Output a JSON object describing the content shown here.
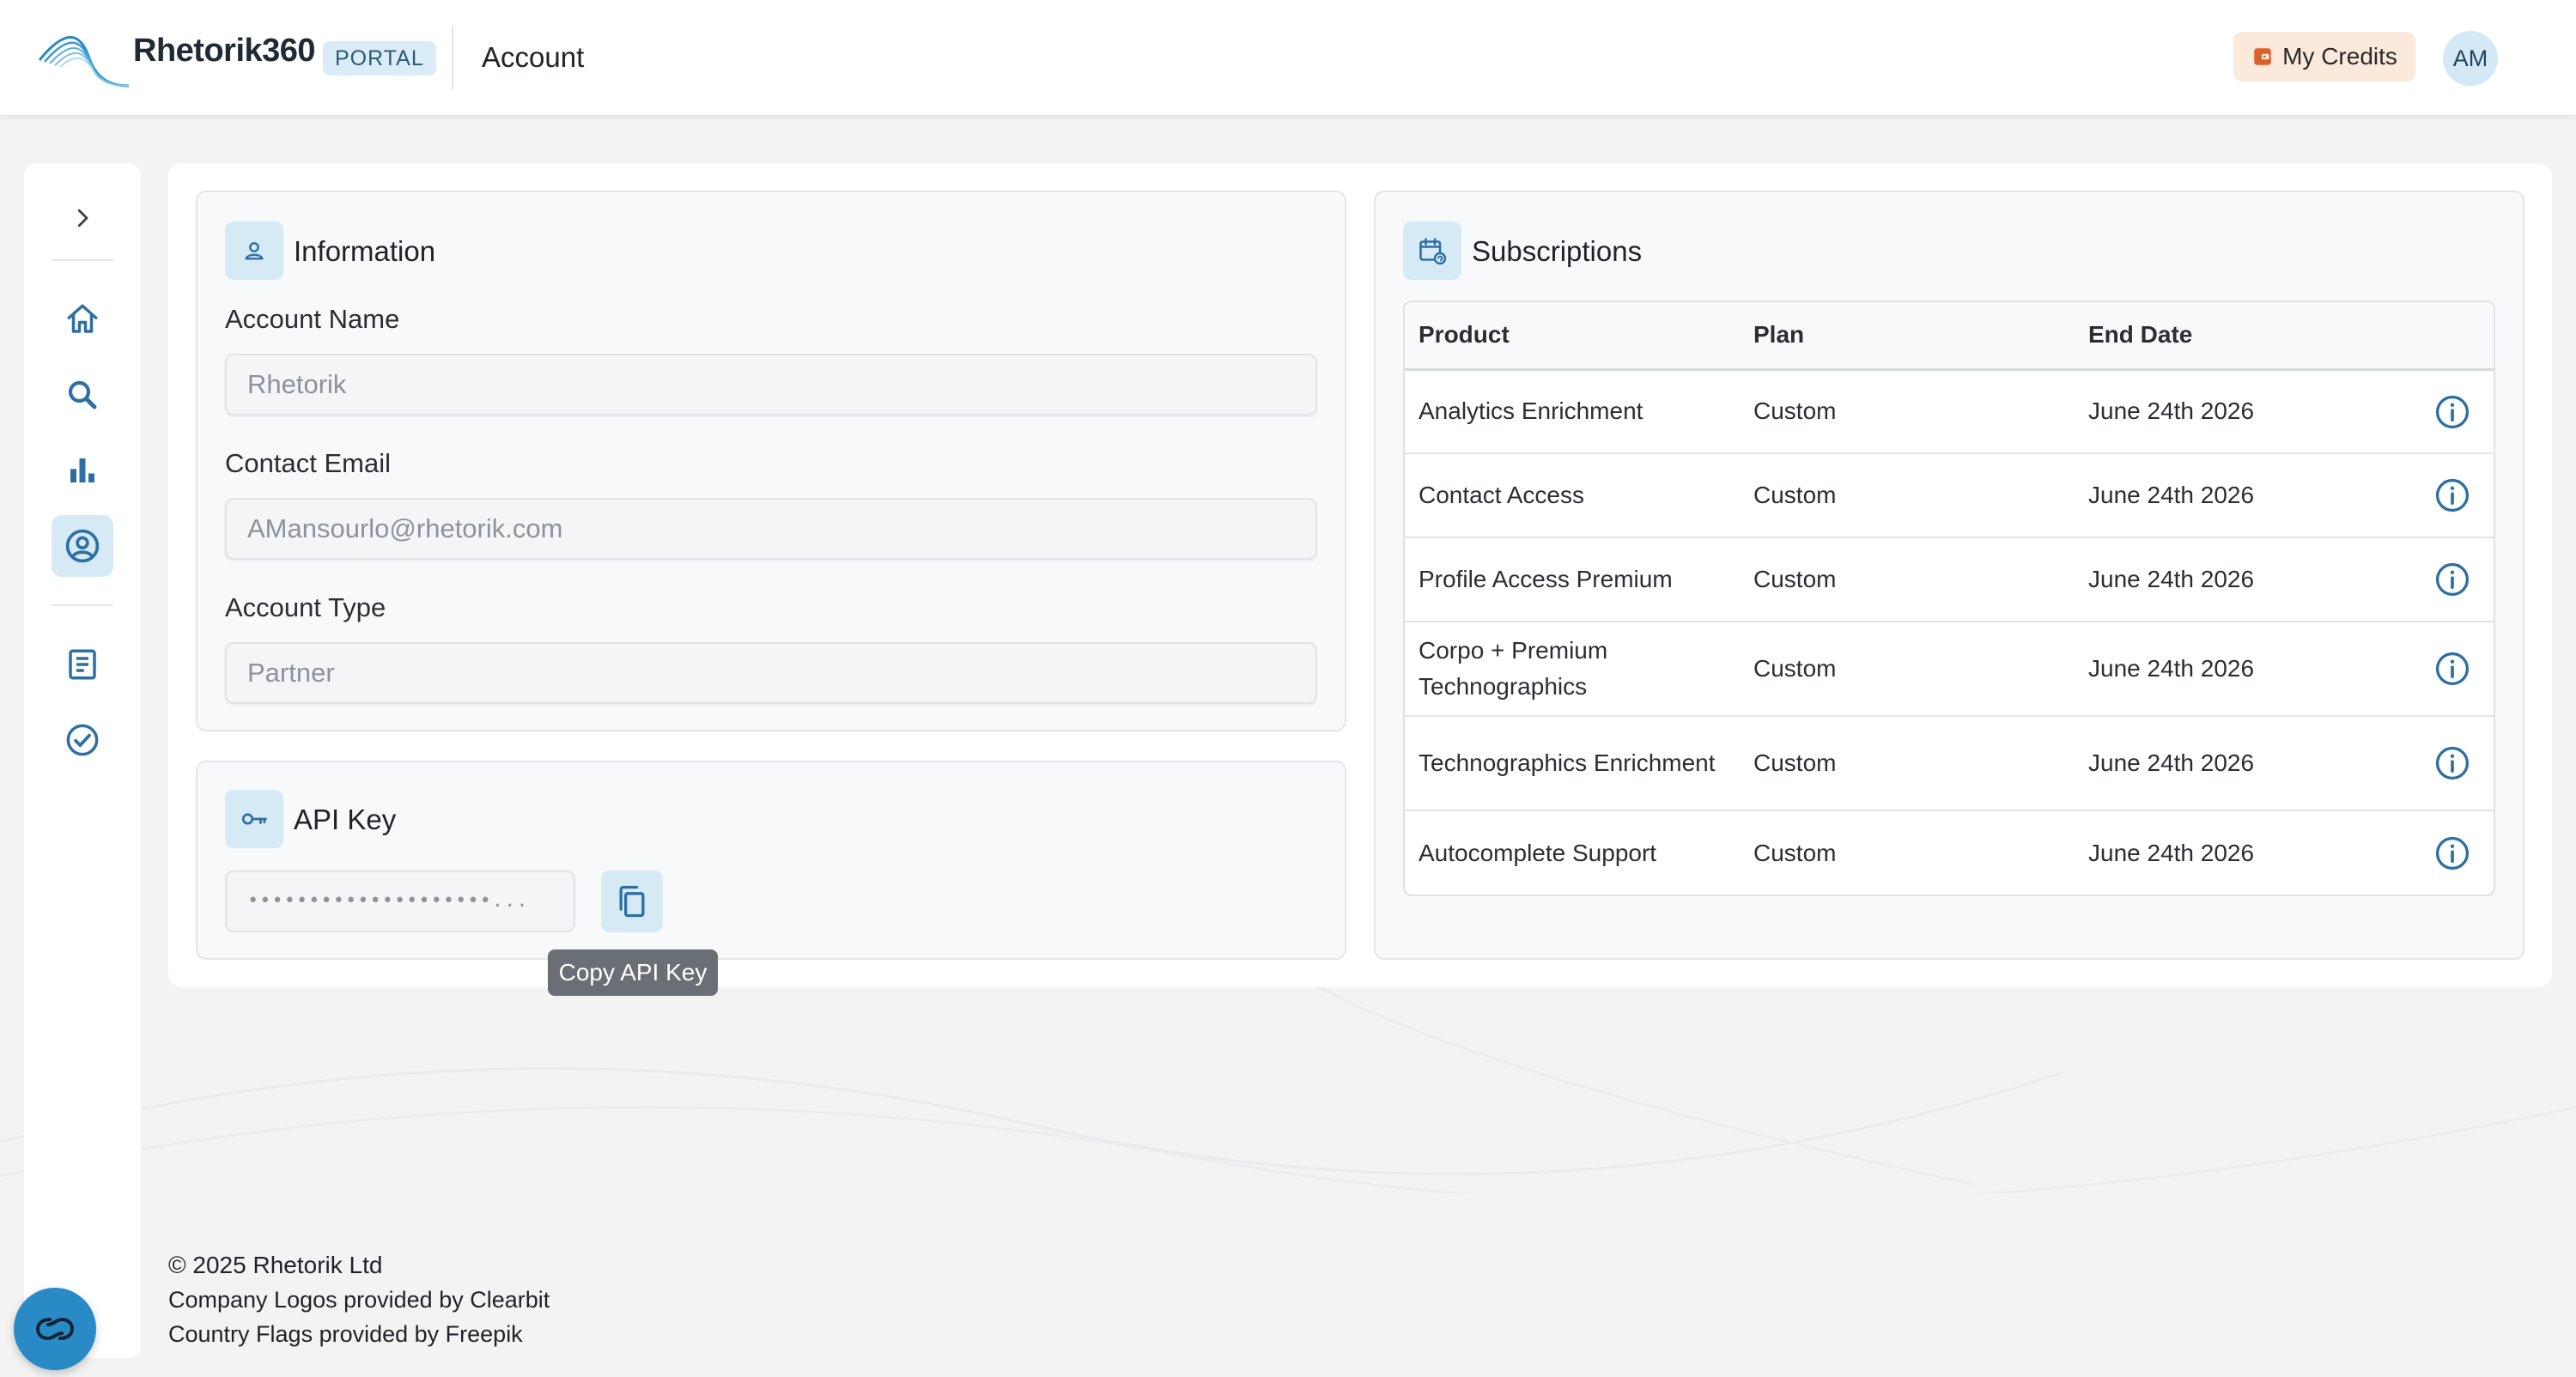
{
  "header": {
    "brand": "Rhetorik360",
    "badge": "PORTAL",
    "page_title": "Account",
    "credits_label": "My Credits",
    "avatar_initials": "AM"
  },
  "information": {
    "title": "Information",
    "account_name_label": "Account Name",
    "account_name_value": "Rhetorik",
    "contact_email_label": "Contact Email",
    "contact_email_value": "AMansourlo@rhetorik.com",
    "account_type_label": "Account Type",
    "account_type_value": "Partner"
  },
  "api_key": {
    "title": "API Key",
    "masked_value": "••••••••••••••••••••...",
    "tooltip": "Copy API Key"
  },
  "subscriptions": {
    "title": "Subscriptions",
    "columns": [
      "Product",
      "Plan",
      "End Date"
    ],
    "rows": [
      {
        "product": "Analytics Enrichment",
        "plan": "Custom",
        "end_date": "June 24th 2026"
      },
      {
        "product": "Contact Access",
        "plan": "Custom",
        "end_date": "June 24th 2026"
      },
      {
        "product": "Profile Access Premium",
        "plan": "Custom",
        "end_date": "June 24th 2026"
      },
      {
        "product": "Corpo + Premium Technographics",
        "plan": "Custom",
        "end_date": "June 24th 2026"
      },
      {
        "product": "Technographics Enrichment",
        "plan": "Custom",
        "end_date": "June 24th 2026"
      },
      {
        "product": "Autocomplete Support",
        "plan": "Custom",
        "end_date": "June 24th 2026"
      }
    ]
  },
  "footer": {
    "copyright": "© 2025 Rhetorik Ltd",
    "logos_credit": "Company Logos provided by Clearbit",
    "flags_credit": "Country Flags provided by Freepik"
  },
  "colors": {
    "accent": "#2a8ac6",
    "icon_blue": "#2e6fa3",
    "badge_bg": "#d6eaf6",
    "credits_bg": "#fbe9dc",
    "credits_icon": "#d9622b"
  },
  "icons": {
    "sidebar": [
      "chevron-right-icon",
      "home-icon",
      "search-icon",
      "bar-chart-icon",
      "account-circle-icon",
      "document-icon",
      "check-circle-icon"
    ],
    "credits": "wallet-icon",
    "info": "person-icon",
    "subscriptions": "calendar-refresh-icon",
    "api_key": "key-icon",
    "copy": "copy-icon",
    "row": "info-circle-icon",
    "chat": "chat-loop-icon"
  }
}
